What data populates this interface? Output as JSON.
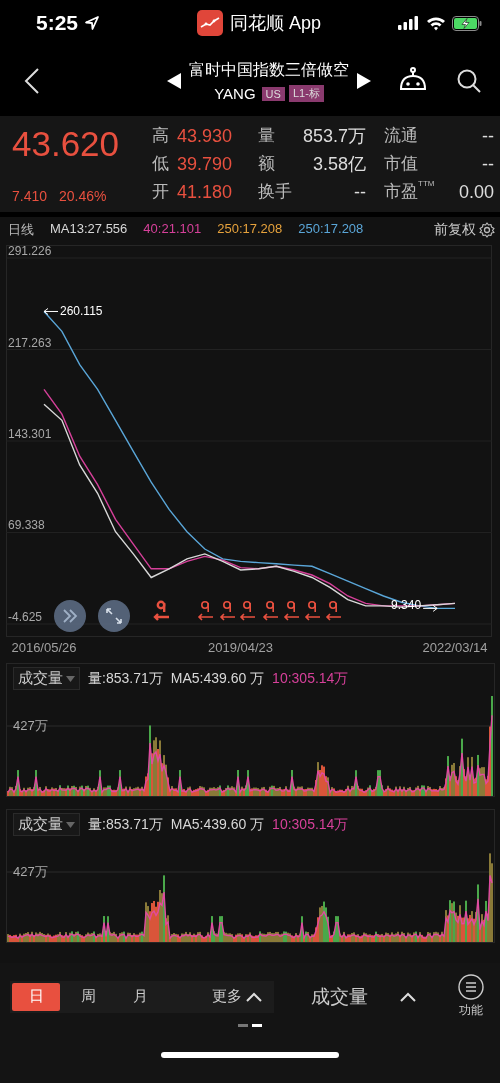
{
  "status_bar": {
    "time": "5:25",
    "app": "同花顺 App"
  },
  "nav": {
    "title": "富时中国指数三倍做空",
    "symbol": "YANG",
    "tags": [
      "US",
      "L1-标"
    ]
  },
  "quote": {
    "price": "43.620",
    "change": "7.410",
    "change_pct": "20.46%",
    "fields": [
      {
        "label": "高",
        "value": "43.930",
        "color": "#e8503f"
      },
      {
        "label": "量",
        "value": "853.7万",
        "color": "#dddddd"
      },
      {
        "label": "流通",
        "value": "--",
        "color": "#dddddd"
      },
      {
        "label": "低",
        "value": "39.790",
        "color": "#e8503f"
      },
      {
        "label": "额",
        "value": "3.58亿",
        "color": "#dddddd"
      },
      {
        "label": "市值",
        "value": "--",
        "color": "#dddddd"
      },
      {
        "label": "开",
        "value": "41.180",
        "color": "#e8503f"
      },
      {
        "label": "换手",
        "value": "--",
        "color": "#dddddd"
      },
      {
        "label": "市盈$^{TTM}$",
        "value": "0.00",
        "color": "#dddddd"
      }
    ]
  },
  "legend": {
    "period": "日线",
    "items": [
      {
        "text": "MA13:27.556",
        "color": "#d8d8d8"
      },
      {
        "text": "40:21.101",
        "color": "#d6409a"
      },
      {
        "text": "250:17.208",
        "color": "#e6a23c"
      },
      {
        "text": "250:17.208",
        "color": "#5aa6d8"
      }
    ],
    "adjust": "前复权"
  },
  "main_chart": {
    "chart_data": {
      "type": "line",
      "categories": [
        "2016/05/26",
        null,
        null,
        null,
        null,
        null,
        null,
        null,
        null,
        null,
        null,
        "2019/04/23",
        null,
        null,
        null,
        null,
        null,
        null,
        null,
        null,
        null,
        null,
        null,
        "2022/03/14"
      ],
      "series": [
        {
          "color": "#d8d8d8",
          "values": [
            173,
            160,
            124,
            101,
            70,
            52,
            33,
            40,
            48,
            52,
            46,
            39,
            40,
            42,
            38,
            33,
            25,
            15,
            10,
            10,
            9,
            10,
            11,
            12
          ]
        },
        {
          "color": "#d6409a",
          "values": [
            185,
            165,
            131,
            108,
            80,
            60,
            40,
            40,
            46,
            50,
            47,
            41,
            40,
            42,
            39,
            35,
            28,
            18,
            12,
            10,
            10,
            10,
            11,
            12
          ]
        },
        {
          "color": "#5aa6d8",
          "values": [
            248,
            232,
            205,
            185,
            160,
            135,
            110,
            88,
            70,
            56,
            48,
            46,
            45,
            44,
            43,
            42,
            36,
            30,
            24,
            18,
            13,
            10,
            8,
            8
          ]
        }
      ],
      "ylim": [
        -4.625,
        291.226
      ],
      "grid": true,
      "yticks": [
        {
          "value": 291.226,
          "label": "291.226"
        },
        {
          "value": 217.263,
          "label": "217.263"
        },
        {
          "value": 143.301,
          "label": "143.301"
        },
        {
          "value": 69.338,
          "label": "69.338"
        },
        {
          "value": -4.625,
          "label": "-4.625"
        }
      ],
      "annotations": [
        "260.115",
        "9.340"
      ]
    },
    "event_markers": [
      {
        "selected": true
      },
      {
        "selected": false
      },
      {
        "selected": false
      },
      {
        "selected": false
      },
      {
        "selected": false
      },
      {
        "selected": false
      },
      {
        "selected": false
      },
      {
        "selected": false
      }
    ]
  },
  "volume_panels": [
    {
      "selector": "成交量",
      "items": [
        {
          "text": "量:853.71万",
          "color": "#d8d8d8"
        },
        {
          "text": "MA5:439.60 万",
          "color": "#d8d8d8"
        },
        {
          "text": "10:305.14万",
          "color": "#d6409a"
        }
      ],
      "tick": "427万"
    },
    {
      "selector": "成交量",
      "items": [
        {
          "text": "量:853.71万",
          "color": "#d8d8d8"
        },
        {
          "text": "MA5:439.60 万",
          "color": "#d8d8d8"
        },
        {
          "text": "10:305.14万",
          "color": "#d6409a"
        }
      ],
      "tick": "427万"
    }
  ],
  "bottom_bar": {
    "periods": [
      {
        "label": "日",
        "selected": true
      },
      {
        "label": "周",
        "selected": false
      },
      {
        "label": "月",
        "selected": false
      }
    ],
    "more": "更多",
    "indicator": "成交量",
    "function": "功能",
    "pages": [
      {
        "selected": false
      },
      {
        "selected": true
      }
    ]
  }
}
